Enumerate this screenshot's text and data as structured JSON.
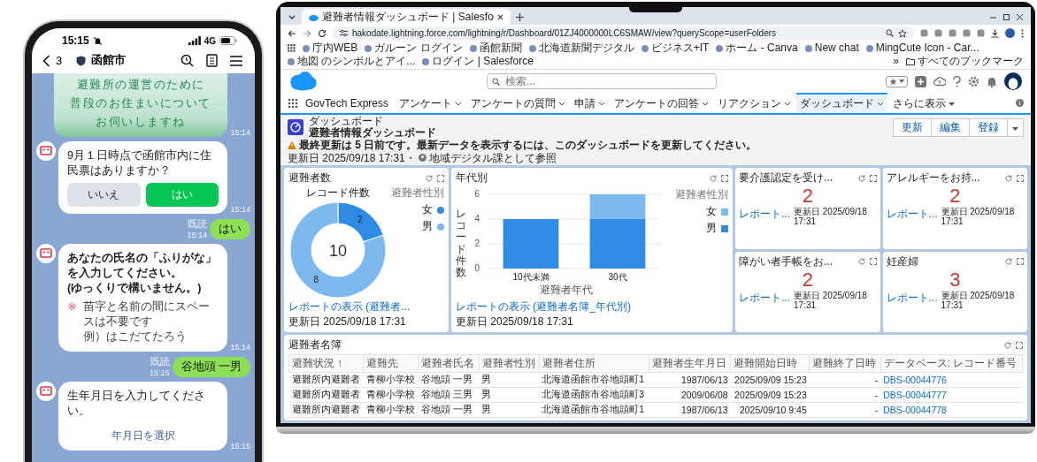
{
  "phone": {
    "status_bar": {
      "time": "15:15",
      "network": "4G"
    },
    "header": {
      "back_count": "3",
      "title": "函館市"
    },
    "messages": [
      {
        "kind": "image",
        "lines": [
          "避難所の運営のために",
          "普段のお住まいについて",
          "お伺いしますね"
        ],
        "time": "15:14"
      },
      {
        "kind": "bot",
        "bold": false,
        "text": "9月１日時点で函館市内に住民票はありますか？",
        "buttons": [
          {
            "label": "いいえ",
            "primary": false
          },
          {
            "label": "はい",
            "primary": true
          }
        ],
        "time": "15:14"
      },
      {
        "kind": "user",
        "text": "はい",
        "read": "既読",
        "time": "15:14"
      },
      {
        "kind": "bot",
        "bold": true,
        "text": "あなたの氏名の「ふりがな」を入力してください。\n(ゆっくりで構いません。)",
        "note": {
          "mark": "※",
          "lines": [
            "苗字と名前の間にスペースは不要です",
            "例）はこだてたろう"
          ]
        },
        "time": "15:14"
      },
      {
        "kind": "user",
        "text": "谷地頭 一男",
        "read": "既読",
        "time": "15:15"
      },
      {
        "kind": "bot",
        "bold": false,
        "text": "生年月日を入力してください。",
        "link": "年月日を選択",
        "time": "15:15"
      }
    ]
  },
  "laptop": {
    "browser": {
      "tab_title": "避難者情報ダッシュボード | Salesfo",
      "url": "hakodate.lightning.force.com/lightning/r/Dashboard/01ZJ4000000LC6SMAW/view?queryScope=userFolders",
      "bookmarks": [
        "庁内WEB",
        "ガルーン ログイン",
        "函館新聞",
        "北海道新聞デジタル",
        "ビジネス+IT",
        "ホーム - Canva",
        "New chat",
        "MingCute Icon - Car...",
        "地図 のシンボルとアイ...",
        "ログイン | Salesforce"
      ],
      "more": "»",
      "all_bookmarks": "すべてのブックマーク"
    },
    "salesforce": {
      "search_placeholder": "検索...",
      "app_name": "GovTech Express",
      "nav": [
        {
          "label": "アンケート",
          "selected": false
        },
        {
          "label": "アンケートの質問",
          "selected": false
        },
        {
          "label": "申請",
          "selected": false
        },
        {
          "label": "アンケートの回答",
          "selected": false
        },
        {
          "label": "リアクション",
          "selected": false
        },
        {
          "label": "ダッシュボード",
          "selected": true
        }
      ],
      "more_nav": "さらに表示"
    },
    "dashboard": {
      "type_label": "ダッシュボード",
      "title": "避難者情報ダッシュボード",
      "warning": "最終更新は 5 日前です。最新データを表示するには、このダッシュボードを更新してください。",
      "updated": "更新日 2025/09/18 17:31・",
      "viewing_as": "地域デジタル課として参照",
      "buttons": [
        "更新",
        "編集",
        "登録"
      ]
    },
    "donut_card": {
      "title": "避難者数",
      "legend_title": "避難者性別",
      "legend": [
        {
          "color": "#2f8be6"
        },
        {
          "color": "#7db9ee"
        }
      ],
      "center_label": "10",
      "chart_data": {
        "type": "donut",
        "title": "レコード件数",
        "categories": [
          "女",
          "男"
        ],
        "values": [
          2,
          8
        ],
        "data_labels": true
      },
      "report_link": "レポートの表示 (避難者...",
      "updated": "更新日 2025/09/18 17:31"
    },
    "bar_card": {
      "title": "年代別",
      "legend_title": "避難者性別",
      "chart_data": {
        "type": "bar",
        "stacked": true,
        "categories": [
          "10代未満",
          "30代"
        ],
        "series": [
          {
            "name": "男",
            "color": "#2f8be6",
            "values": [
              4,
              4
            ]
          },
          {
            "name": "女",
            "color": "#7db9ee",
            "values": [
              0,
              2
            ]
          }
        ],
        "ylim": [
          0,
          6
        ],
        "yticks": [
          0,
          2,
          4,
          6
        ],
        "xlabel": "避難者年代",
        "ylabel": "レコード件数"
      },
      "report_link": "レポートの表示 (避難者名簿_年代別)",
      "updated": "更新日 2025/09/18 17:31"
    },
    "metrics": [
      {
        "title": "要介護認定を受け...",
        "value": "2",
        "link": "レポート...",
        "updated": "更新日 2025/09/18 17:31"
      },
      {
        "title": "アレルギーをお持...",
        "value": "2",
        "link": "レポート...",
        "updated": "更新日 2025/09/18 17:31"
      },
      {
        "title": "障がい者手帳をお...",
        "value": "2",
        "link": "レポート...",
        "updated": "更新日 2025/09/18 17:31"
      },
      {
        "title": "妊産婦",
        "value": "3",
        "link": "レポート...",
        "updated": "更新日 2025/09/18 17:31"
      }
    ],
    "table": {
      "title": "避難者名簿",
      "sort_mark": "↑",
      "columns": [
        "避難状況",
        "避難先",
        "避難者氏名",
        "避難者性別",
        "避難者住所",
        "避難者生年月日",
        "避難開始日時",
        "避難終了日時",
        "データベース: レコード番号"
      ],
      "rows": [
        [
          "避難所内避難者",
          "青柳小学校",
          "谷地頭 一男",
          "男",
          "北海道函館市谷地頭町1",
          "1987/06/13",
          "2025/09/09 15:23",
          "-",
          "DBS-00044776"
        ],
        [
          "避難所内避難者",
          "青柳小学校",
          "谷地頭 三男",
          "男",
          "北海道函館市谷地頭町3",
          "2009/06/08",
          "2025/09/09 15:23",
          "-",
          "DBS-00044777"
        ],
        [
          "避難所内避難者",
          "青柳小学校",
          "谷地頭 一男",
          "男",
          "北海道函館市谷地頭町1",
          "1987/06/13",
          "2025/09/10 9:45",
          "-",
          "DBS-00044778"
        ]
      ]
    }
  }
}
